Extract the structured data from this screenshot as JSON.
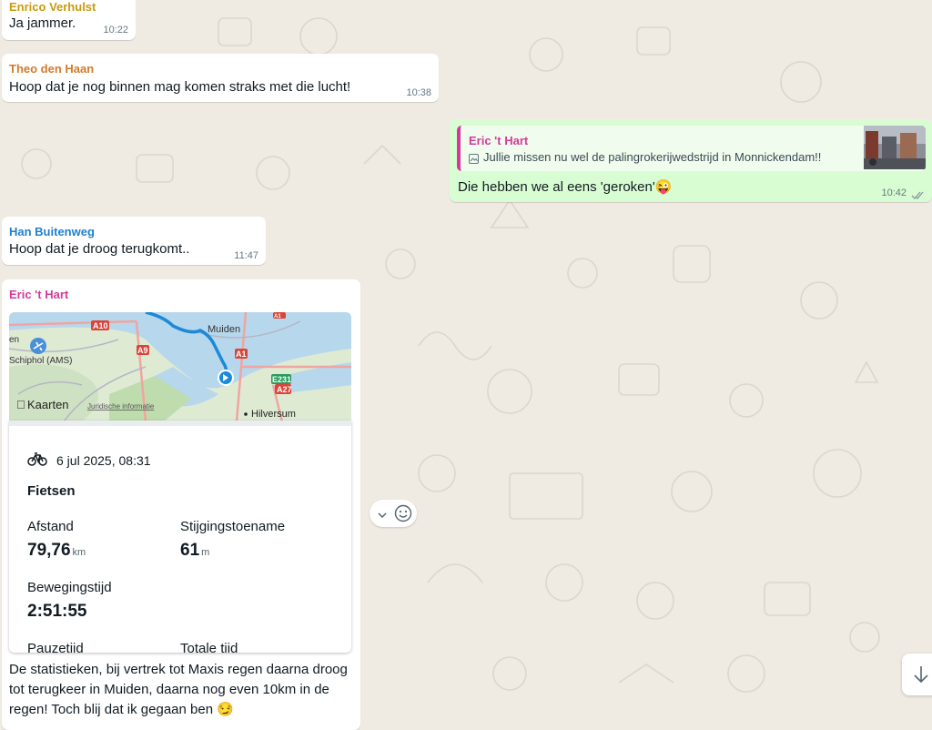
{
  "messages": [
    {
      "sender": "Enrico Verhulst",
      "sender_color": "#c89b0b",
      "text": "Ja jammer.",
      "time": "10:22"
    },
    {
      "sender": "Theo den Haan",
      "sender_color": "#d27b2b",
      "text": "Hoop dat je nog binnen mag komen straks met die lucht!",
      "time": "10:38"
    },
    {
      "quote_sender": "Eric 't Hart",
      "quote_text": "Jullie missen nu wel de palingrokerijwedstrijd in Monnickendam!!",
      "text": "Die hebben we al eens 'geroken'😜",
      "time": "10:42",
      "status": "read"
    },
    {
      "sender": "Han Buitenweg",
      "sender_color": "#1f7fd1",
      "text": "Hoop dat je droog terugkomt..",
      "time": "11:47"
    },
    {
      "sender": "Eric 't Hart",
      "sender_color": "#d43a9b",
      "caption": "De statistieken, bij vertrek tot Maxis regen daarna droog tot terugkeer in Muiden, daarna nog even 10km in de regen! Toch blij dat ik gegaan ben 😏"
    }
  ],
  "map": {
    "labels": {
      "muiden": "Muiden",
      "schiphol": "Schiphol (AMS)",
      "hilversum": "Hilversum",
      "kaarten": "Kaarten",
      "legal": "Juridische informatie",
      "en": "en"
    },
    "road_shields": [
      "A10",
      "A9",
      "A1",
      "E231",
      "A27",
      "A1"
    ]
  },
  "workout": {
    "icon": "bicycle-icon",
    "date": "6 jul 2025, 08:31",
    "type": "Fietsen",
    "distance_label": "Afstand",
    "distance_value": "79,76",
    "distance_unit": "km",
    "elevation_label": "Stijgingstoename",
    "elevation_value": "61",
    "elevation_unit": "m",
    "moving_label": "Bewegingstijd",
    "moving_value": "2:51:55",
    "pause_label": "Pauzetijd",
    "total_label": "Totale tijd"
  },
  "controls": {
    "chevron": "chevron-down-icon",
    "emoji": "emoji-icon",
    "scroll": "arrow-down-icon"
  },
  "colors": {
    "background": "#efeae2",
    "outgoing": "#d9fdd3",
    "incoming": "#ffffff",
    "read_ticks": "#53bdeb"
  }
}
